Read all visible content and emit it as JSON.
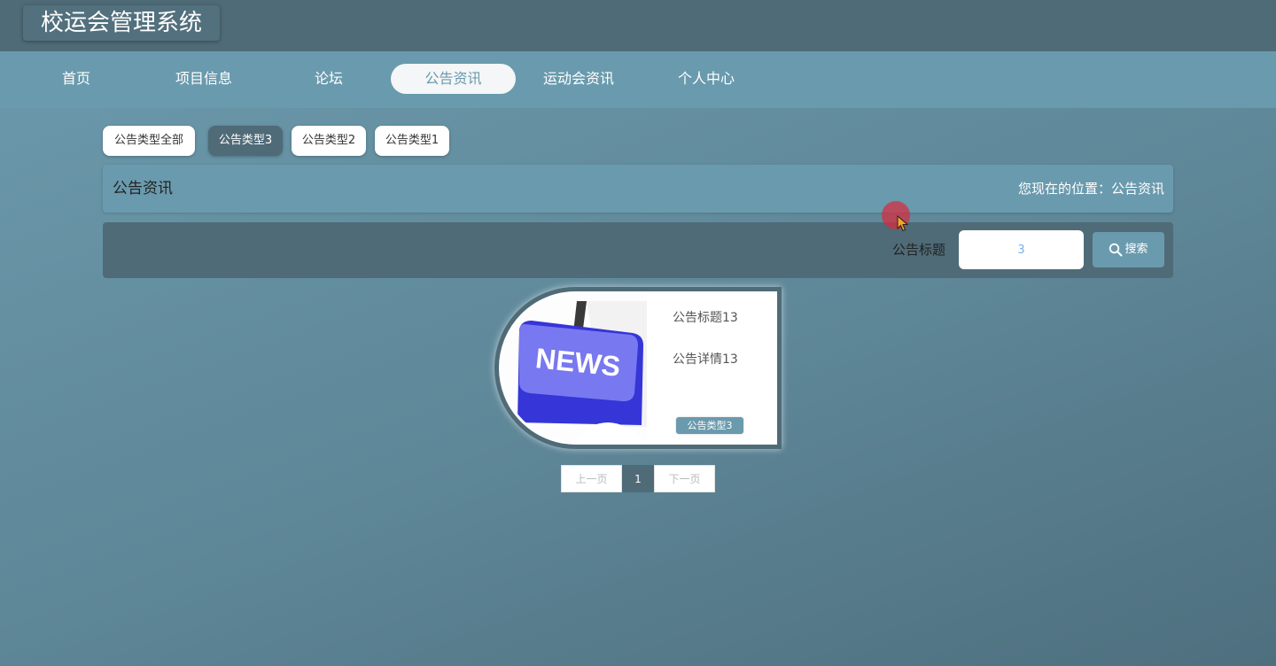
{
  "app": {
    "title": "校运会管理系统"
  },
  "nav": {
    "items": [
      {
        "label": "首页",
        "active": false
      },
      {
        "label": "项目信息",
        "active": false
      },
      {
        "label": "论坛",
        "active": false
      },
      {
        "label": "公告资讯",
        "active": true
      },
      {
        "label": "运动会资讯",
        "active": false
      },
      {
        "label": "个人中心",
        "active": false
      }
    ]
  },
  "filters": {
    "items": [
      {
        "label": "公告类型全部",
        "active": false
      },
      {
        "label": "公告类型3",
        "active": true
      },
      {
        "label": "公告类型2",
        "active": false
      },
      {
        "label": "公告类型1",
        "active": false
      }
    ]
  },
  "breadcrumb": {
    "title": "公告资讯",
    "location": "您现在的位置：公告资讯"
  },
  "search": {
    "label": "公告标题",
    "value": "3",
    "button_label": "搜索"
  },
  "cards": [
    {
      "image_text": "NEWS",
      "title": "公告标题13",
      "detail": "公告详情13",
      "badge": "公告类型3"
    }
  ],
  "pagination": {
    "prev": "上一页",
    "current": "1",
    "next": "下一页"
  },
  "colors": {
    "primary": "#4f6b77",
    "accent": "#6a9aad",
    "news_key": "#6f6ef0"
  }
}
